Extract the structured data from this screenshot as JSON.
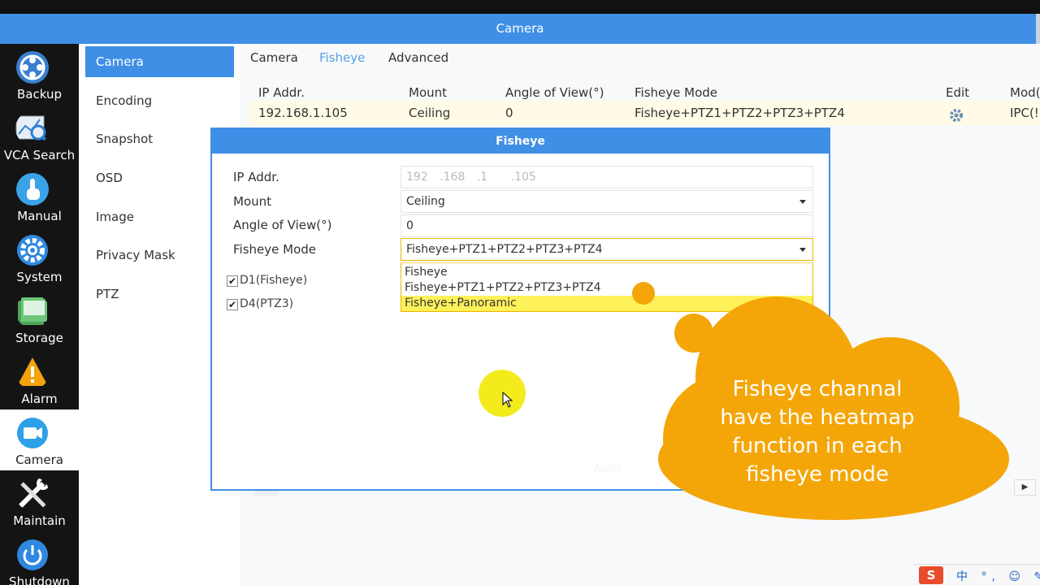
{
  "window": {
    "title": "Camera"
  },
  "rail": {
    "items": [
      {
        "label": "Backup",
        "icon": "backup-icon"
      },
      {
        "label": "VCA Search",
        "icon": "vca-search-icon"
      },
      {
        "label": "Manual",
        "icon": "manual-icon"
      },
      {
        "label": "System",
        "icon": "gear-icon"
      },
      {
        "label": "Storage",
        "icon": "storage-icon"
      },
      {
        "label": "Alarm",
        "icon": "alarm-icon"
      },
      {
        "label": "Camera",
        "icon": "camera-icon",
        "active": true
      },
      {
        "label": "Maintain",
        "icon": "maintain-icon"
      },
      {
        "label": "Shutdown",
        "icon": "power-icon"
      }
    ]
  },
  "submenu": {
    "items": [
      "Camera",
      "Encoding",
      "Snapshot",
      "OSD",
      "Image",
      "Privacy Mask",
      "PTZ"
    ]
  },
  "tabs": [
    "Camera",
    "Fisheye",
    "Advanced"
  ],
  "table": {
    "headers": [
      "IP Addr.",
      "Mount",
      "Angle of View(°)",
      "Fisheye Mode",
      "Edit",
      "Model"
    ],
    "header_visible": [
      "IP Addr.",
      "Mount",
      "Angle of View(°)",
      "Fisheye Mode",
      "Edit",
      "Mod("
    ],
    "row": {
      "ip": "192.168.1.105",
      "mount": "Ceiling",
      "angle": "0",
      "mode": "Fisheye+PTZ1+PTZ2+PTZ3+PTZ4",
      "model": "IPC(!"
    }
  },
  "dialog": {
    "title": "Fisheye",
    "labels": {
      "ip": "IP Addr.",
      "mount": "Mount",
      "angle": "Angle of View(°)",
      "mode": "Fisheye Mode"
    },
    "ip_parts": [
      "192",
      ".168",
      ".1",
      ".105"
    ],
    "mount_value": "Ceiling",
    "angle_value": "0",
    "mode_value": "Fisheye+PTZ1+PTZ2+PTZ3+PTZ4",
    "mode_options": [
      "Fisheye",
      "Fisheye+PTZ1+PTZ2+PTZ3+PTZ4",
      "Fisheye+Panoramic"
    ],
    "highlighted_option": "Fisheye+Panoramic",
    "checkboxes": [
      {
        "label": "D1(Fisheye)",
        "checked": true
      },
      {
        "label": "D4(PTZ3)",
        "checked": true
      }
    ],
    "faint_button": "Apply"
  },
  "callout": {
    "lines": [
      "Fisheye channal",
      "have the heatmap",
      "function in each",
      "fisheye mode"
    ],
    "color": "#f4a609"
  },
  "ime": {
    "logo": "S",
    "text": "中 °, ☺ ✎"
  },
  "colors": {
    "accent": "#3f8fe6",
    "highlight": "#fff15a",
    "callout": "#f4a609"
  }
}
